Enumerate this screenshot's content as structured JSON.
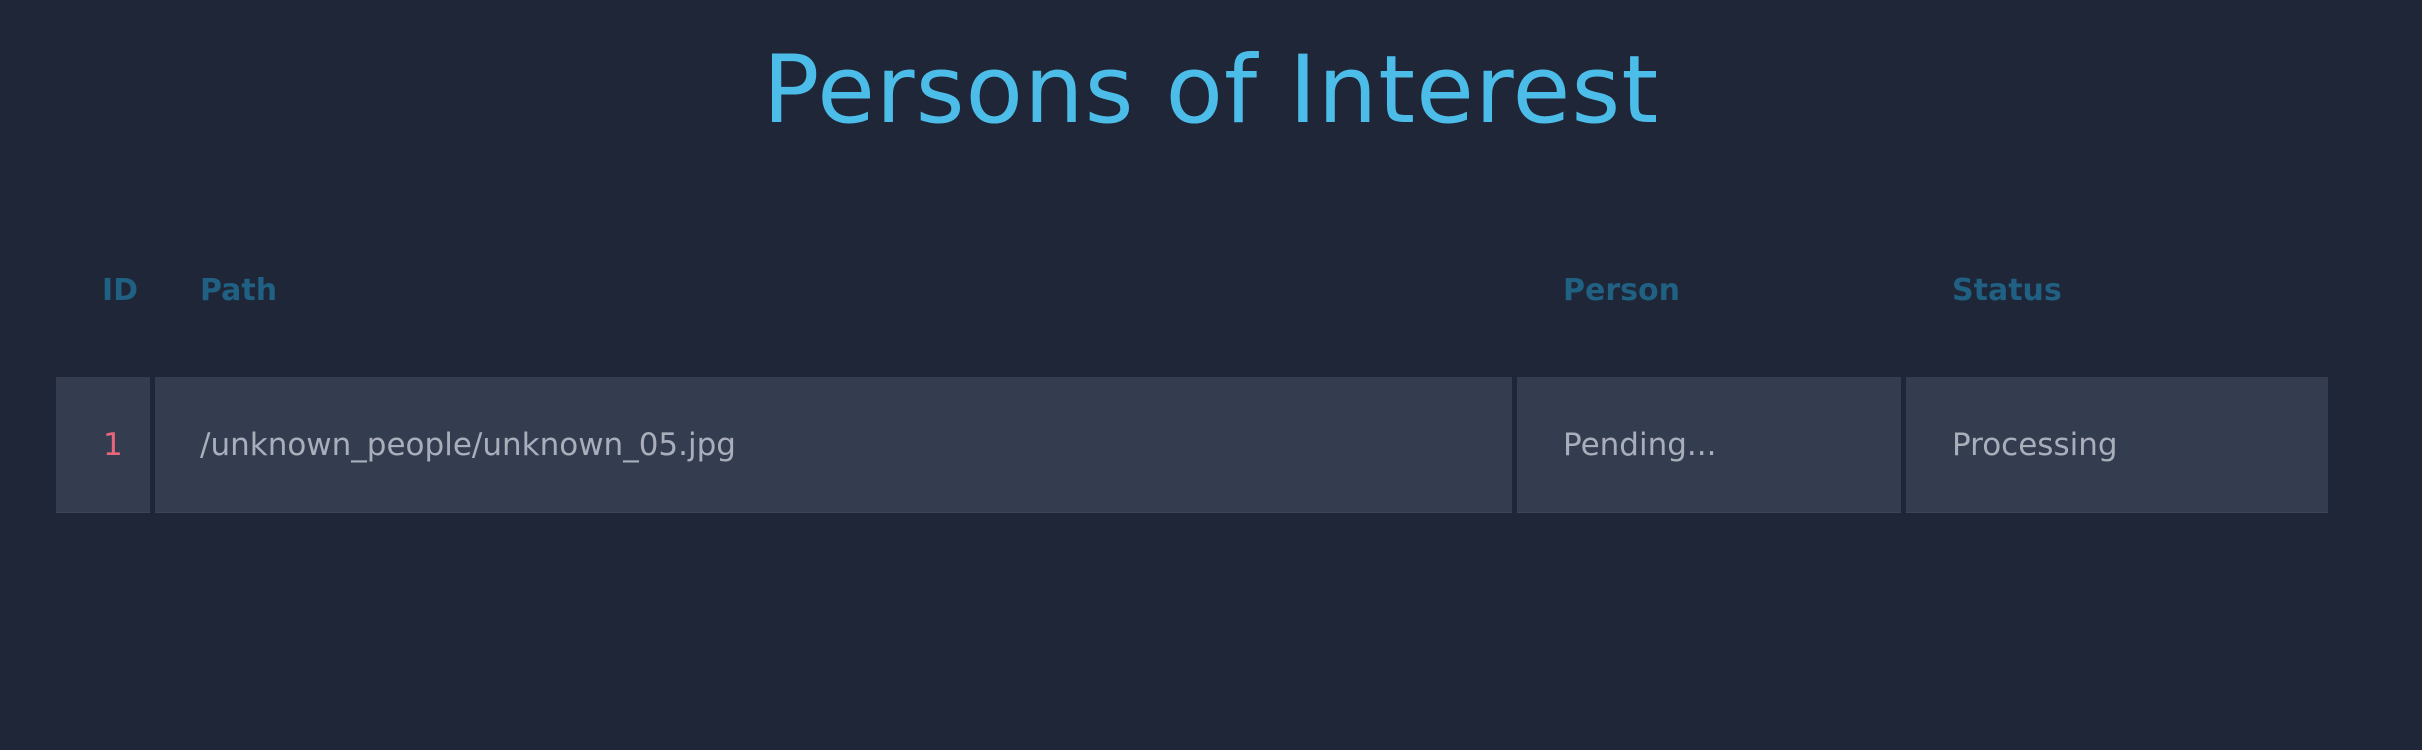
{
  "page": {
    "title": "Persons of Interest"
  },
  "table": {
    "headers": {
      "id": "ID",
      "path": "Path",
      "person": "Person",
      "status": "Status"
    },
    "rows": [
      {
        "id": "1",
        "path": "/unknown_people/unknown_05.jpg",
        "person": "Pending...",
        "status": "Processing"
      }
    ]
  },
  "colors": {
    "background": "#1f2637",
    "title": "#4cbde9",
    "header_text": "#1f6083",
    "row_background": "#343d50",
    "cell_text": "#a9aebb",
    "id_text": "#e8667c"
  }
}
